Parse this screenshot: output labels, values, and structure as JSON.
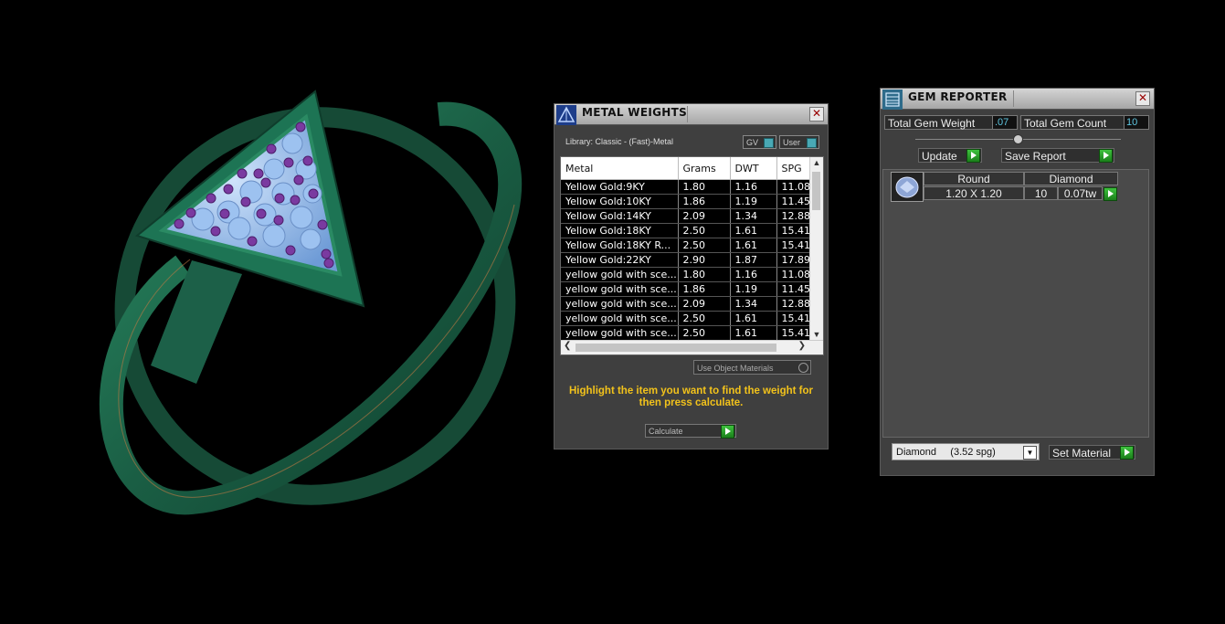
{
  "metal_weights": {
    "title": "METAL WEIGHTS",
    "library": "Library: Classic - (Fast)-Metal",
    "toggle_gv": "GV",
    "toggle_user": "User",
    "columns": [
      "Metal",
      "Grams",
      "DWT",
      "SPG"
    ],
    "rows": [
      [
        "Yellow Gold:9KY",
        "1.80",
        "1.16",
        "11.08"
      ],
      [
        "Yellow Gold:10KY",
        "1.86",
        "1.19",
        "11.45"
      ],
      [
        "Yellow Gold:14KY",
        "2.09",
        "1.34",
        "12.88"
      ],
      [
        "Yellow Gold:18KY",
        "2.50",
        "1.61",
        "15.41"
      ],
      [
        "Yellow Gold:18KY R...",
        "2.50",
        "1.61",
        "15.41"
      ],
      [
        "Yellow Gold:22KY",
        "2.90",
        "1.87",
        "17.89"
      ],
      [
        "yellow gold with sce...",
        "1.80",
        "1.16",
        "11.08"
      ],
      [
        "yellow gold with sce...",
        "1.86",
        "1.19",
        "11.45"
      ],
      [
        "yellow gold with sce...",
        "2.09",
        "1.34",
        "12.88"
      ],
      [
        "yellow gold with sce...",
        "2.50",
        "1.61",
        "15.41"
      ],
      [
        "yellow gold with sce...",
        "2.50",
        "1.61",
        "15.41"
      ]
    ],
    "use_object_materials": "Use Object Materials",
    "hint": "Highlight the item you want to find the weight for then press calculate.",
    "calculate": "Calculate"
  },
  "gem_reporter": {
    "title": "GEM REPORTER",
    "total_weight_label": "Total Gem Weight",
    "total_weight_value": ".07",
    "total_count_label": "Total Gem Count",
    "total_count_value": "10",
    "update": "Update",
    "save_report": "Save Report",
    "gem": {
      "shape": "Round",
      "material": "Diamond",
      "size": "1.20 X 1.20",
      "count": "10",
      "weight": "0.07tw"
    },
    "material_select": "Diamond     (3.52 spg)",
    "set_material": "Set Material"
  },
  "colors": {
    "ring_green": "#1f6b4e",
    "stone_blue": "#8ab4e6",
    "prong_purple": "#7a3aa0",
    "hint_yellow": "#f2c21b",
    "value_cyan": "#5fc6e0"
  }
}
